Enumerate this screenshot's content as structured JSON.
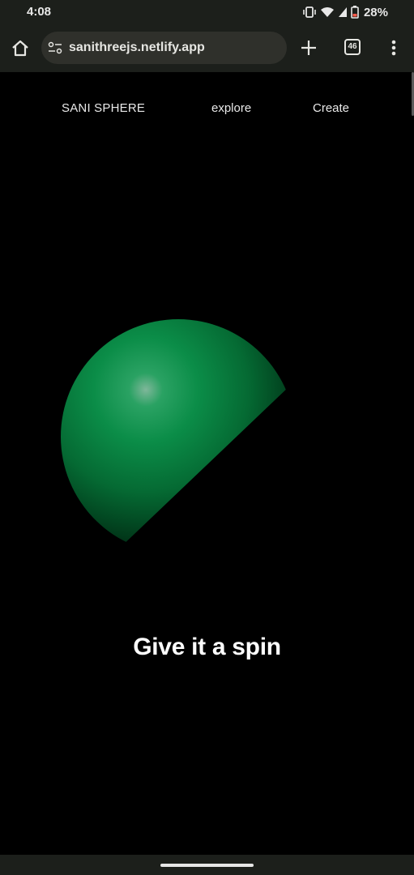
{
  "status_bar": {
    "time": "4:08",
    "battery": "28%",
    "icons": [
      "vibrate-icon",
      "wifi-icon",
      "signal-icon",
      "battery-icon"
    ]
  },
  "browser": {
    "url": "sanithreejs.netlify.app",
    "tab_count": "46",
    "icons": [
      "home-icon",
      "site-settings-icon",
      "plus-icon",
      "tab-switcher-icon",
      "more-vert-icon"
    ]
  },
  "nav": {
    "brand": "SANI SPHERE",
    "explore": "explore",
    "create": "Create"
  },
  "hero": {
    "headline": "Give it a spin",
    "sphere_color": "#0a8a45"
  },
  "colors": {
    "chrome_bg": "#1c1f1b",
    "url_pill_bg": "#2f302b",
    "page_bg": "#000000"
  }
}
